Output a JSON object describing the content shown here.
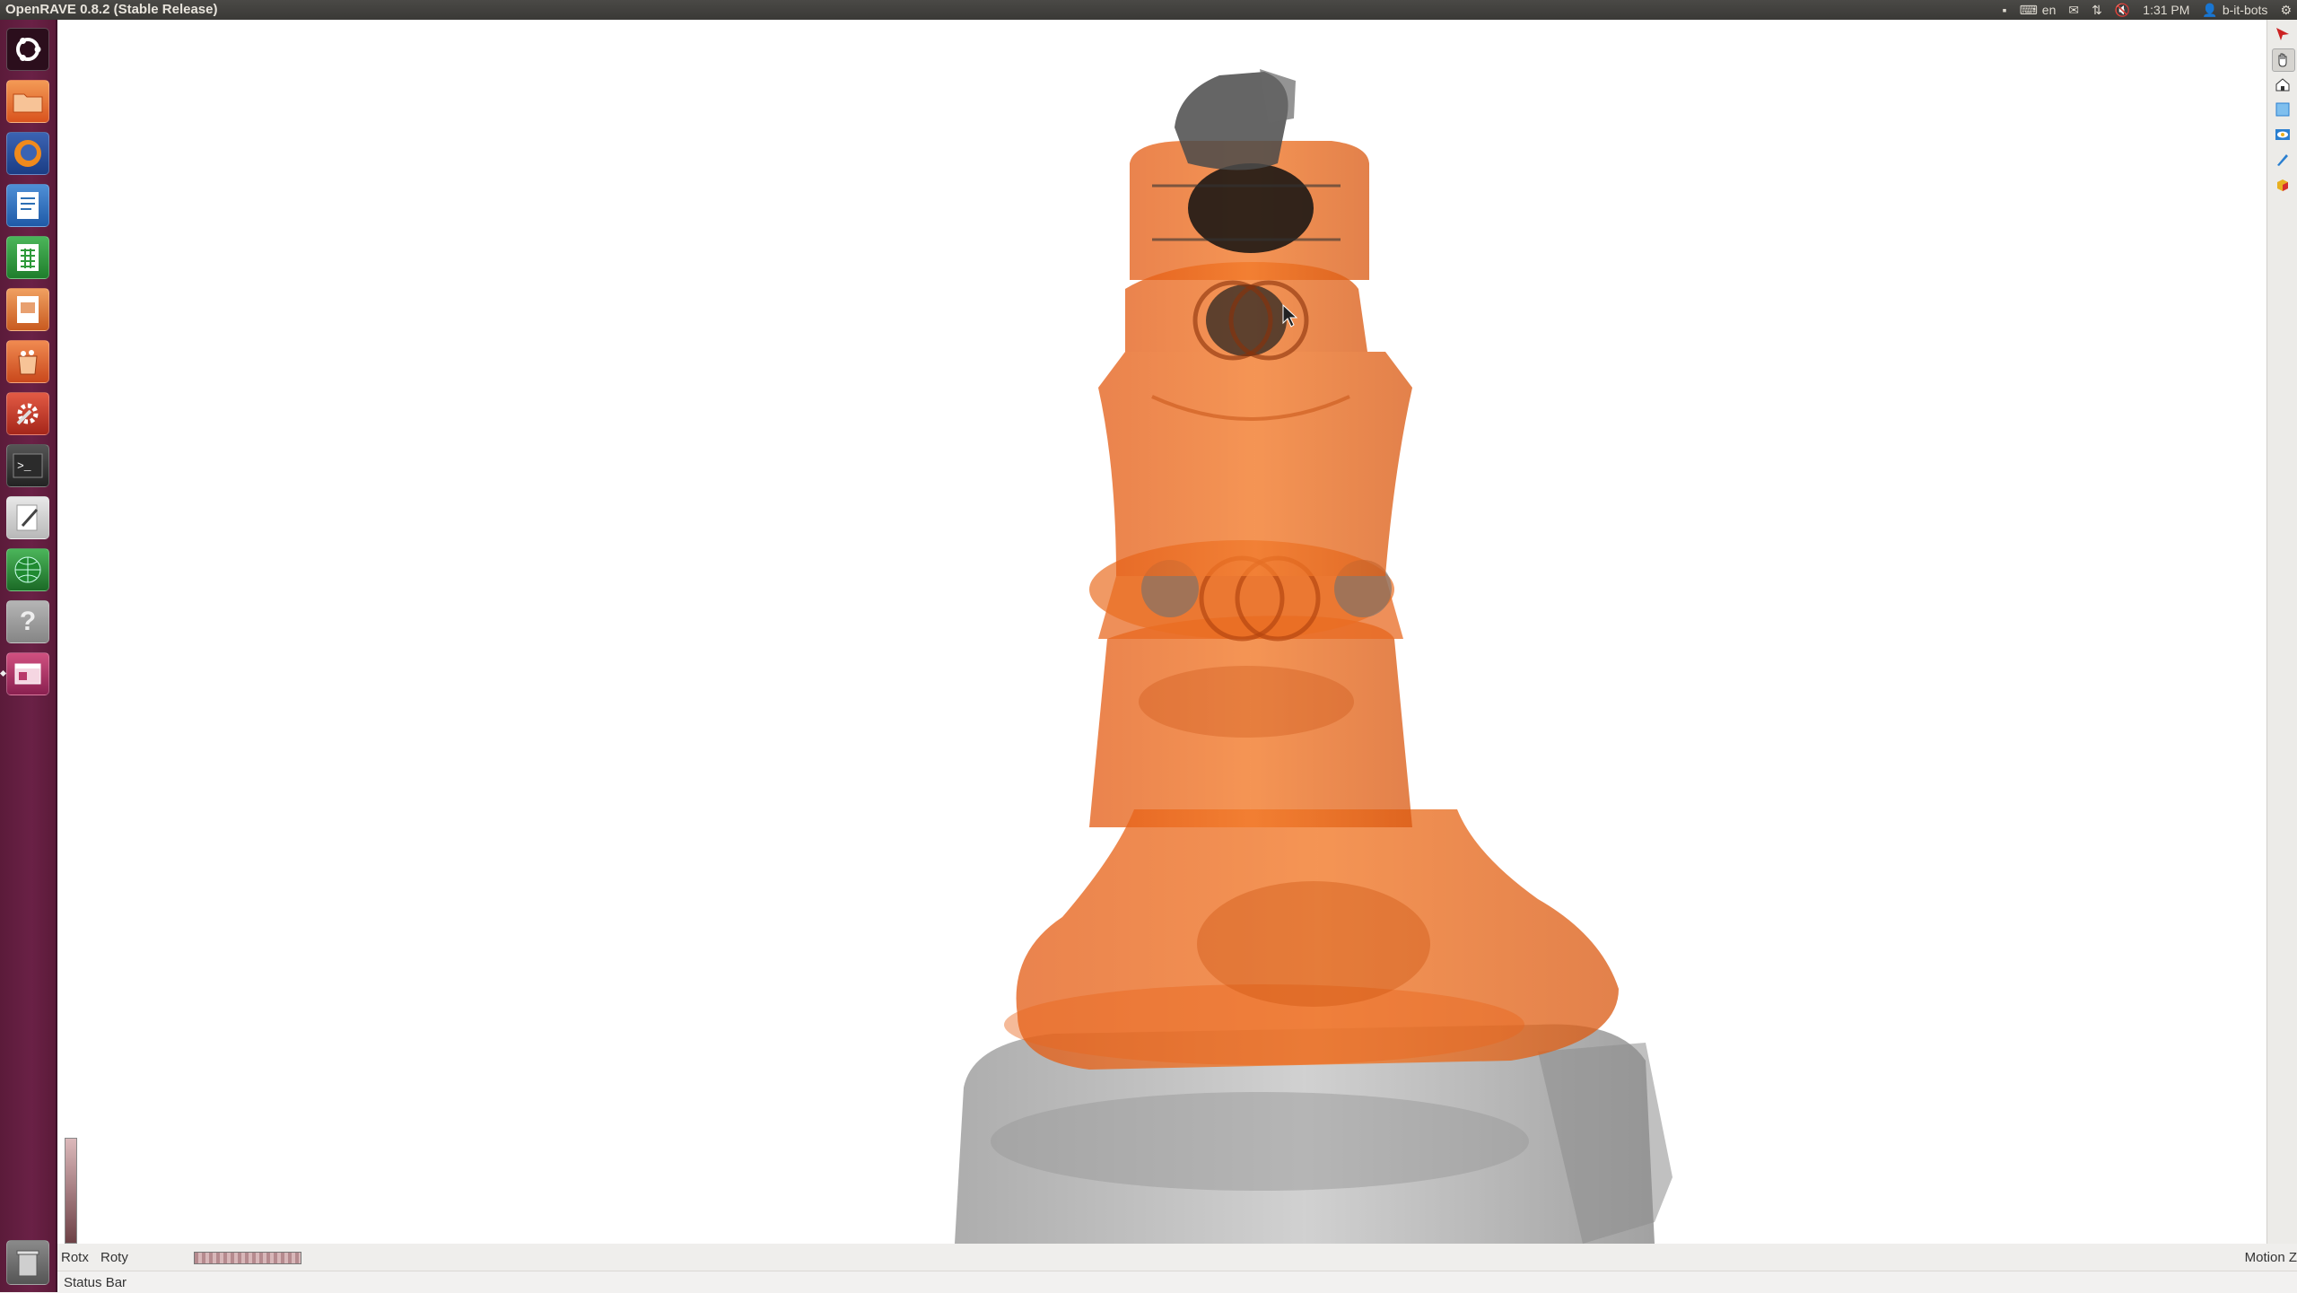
{
  "window": {
    "title": "OpenRAVE 0.8.2 (Stable Release)"
  },
  "panel": {
    "keyboard_layout": "en",
    "time": "1:31 PM",
    "user": "b-it-bots",
    "icons": [
      "network-icon",
      "keyboard-icon",
      "mail-icon",
      "transfer-icon",
      "volume-icon",
      "user-icon",
      "gear-icon"
    ]
  },
  "launcher": {
    "items": [
      {
        "name": "dash-home",
        "icon": "ubuntu-logo-icon",
        "color": "#e8442e"
      },
      {
        "name": "files",
        "icon": "folder-icon",
        "color": "#e8662c"
      },
      {
        "name": "firefox",
        "icon": "firefox-icon",
        "color": "#f08a1c"
      },
      {
        "name": "writer",
        "icon": "writer-document-icon",
        "color": "#2d6fb5"
      },
      {
        "name": "calc",
        "icon": "calc-spreadsheet-icon",
        "color": "#2e9a3a"
      },
      {
        "name": "impress",
        "icon": "impress-presentation-icon",
        "color": "#d86a2c"
      },
      {
        "name": "software-center",
        "icon": "software-center-bag-icon",
        "color": "#e06a2a"
      },
      {
        "name": "system-settings",
        "icon": "settings-wrench-icon",
        "color": "#cc3a2a"
      },
      {
        "name": "terminal",
        "icon": "terminal-icon",
        "color": "#2e2e2e"
      },
      {
        "name": "text-editor",
        "icon": "text-editor-icon",
        "color": "#d9d9d9"
      },
      {
        "name": "globe-app",
        "icon": "globe-icon",
        "color": "#2e9a3a"
      },
      {
        "name": "help",
        "icon": "help-question-icon",
        "color": "#9a9a9a"
      },
      {
        "name": "openrave",
        "icon": "window-app-icon",
        "color": "#b8386a"
      }
    ],
    "trash": "trash-icon"
  },
  "toolbar": {
    "buttons": [
      {
        "name": "pick-tool",
        "icon": "arrow-pointer-icon",
        "color": "#cc2222"
      },
      {
        "name": "view-tool",
        "icon": "hand-icon",
        "color": "#333333"
      },
      {
        "name": "home-view",
        "icon": "house-icon",
        "color": "#333333"
      },
      {
        "name": "view-all",
        "icon": "view-all-icon",
        "color": "#2a7fd0"
      },
      {
        "name": "seek",
        "icon": "eye-icon",
        "color": "#2a7fd0"
      },
      {
        "name": "perspective",
        "icon": "pen-icon",
        "color": "#2a7fd0"
      },
      {
        "name": "render-mode",
        "icon": "cube-color-icon",
        "color": "#d62e2e"
      }
    ]
  },
  "wheels": {
    "rotx_label": "Rotx",
    "roty_label": "Roty",
    "motionz_label": "Motion Z"
  },
  "status": {
    "text": "Status Bar"
  },
  "scene": {
    "robot_color": "#e8651c",
    "base_color": "#6b6b6b",
    "background": "#ffffff"
  }
}
